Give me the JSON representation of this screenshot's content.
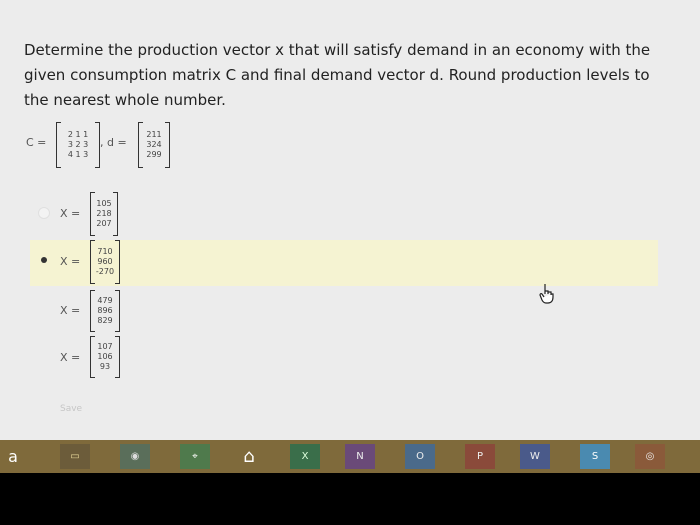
{
  "question": {
    "text": "Determine the production vector x that will satisfy demand in an economy with the given consumption matrix C and final demand vector d. Round production levels to the nearest whole number."
  },
  "given": {
    "c_label": "C =",
    "c_rows": [
      "2 1 1",
      "3 2 3",
      "4 1 3"
    ],
    "d_label": ", d =",
    "d_rows": [
      "211",
      "324",
      "299"
    ]
  },
  "options": [
    {
      "label": "X =",
      "values": [
        "105",
        "218",
        "207"
      ],
      "selected": false
    },
    {
      "label": "X =",
      "values": [
        "710",
        "960",
        "-270"
      ],
      "selected": true
    },
    {
      "label": "X =",
      "values": [
        "479",
        "896",
        "829"
      ],
      "selected": false
    },
    {
      "label": "X =",
      "values": [
        "107",
        "106",
        "93"
      ],
      "selected": false
    }
  ],
  "save_label": "Save",
  "taskbar": {
    "items": [
      {
        "name": "amazon-icon",
        "glyph": "a"
      },
      {
        "name": "folder-icon",
        "glyph": "▭"
      },
      {
        "name": "chrome-icon",
        "glyph": "◉"
      },
      {
        "name": "maps-icon",
        "glyph": "⌖"
      },
      {
        "name": "home-icon",
        "glyph": "⌂"
      },
      {
        "name": "excel-icon",
        "glyph": "X"
      },
      {
        "name": "onenote-icon",
        "glyph": "N"
      },
      {
        "name": "outlook-icon",
        "glyph": "O"
      },
      {
        "name": "powerpoint-icon",
        "glyph": "P"
      },
      {
        "name": "word-icon",
        "glyph": "W"
      },
      {
        "name": "skype-icon",
        "glyph": "S"
      },
      {
        "name": "camera-icon",
        "glyph": "◎"
      }
    ]
  }
}
